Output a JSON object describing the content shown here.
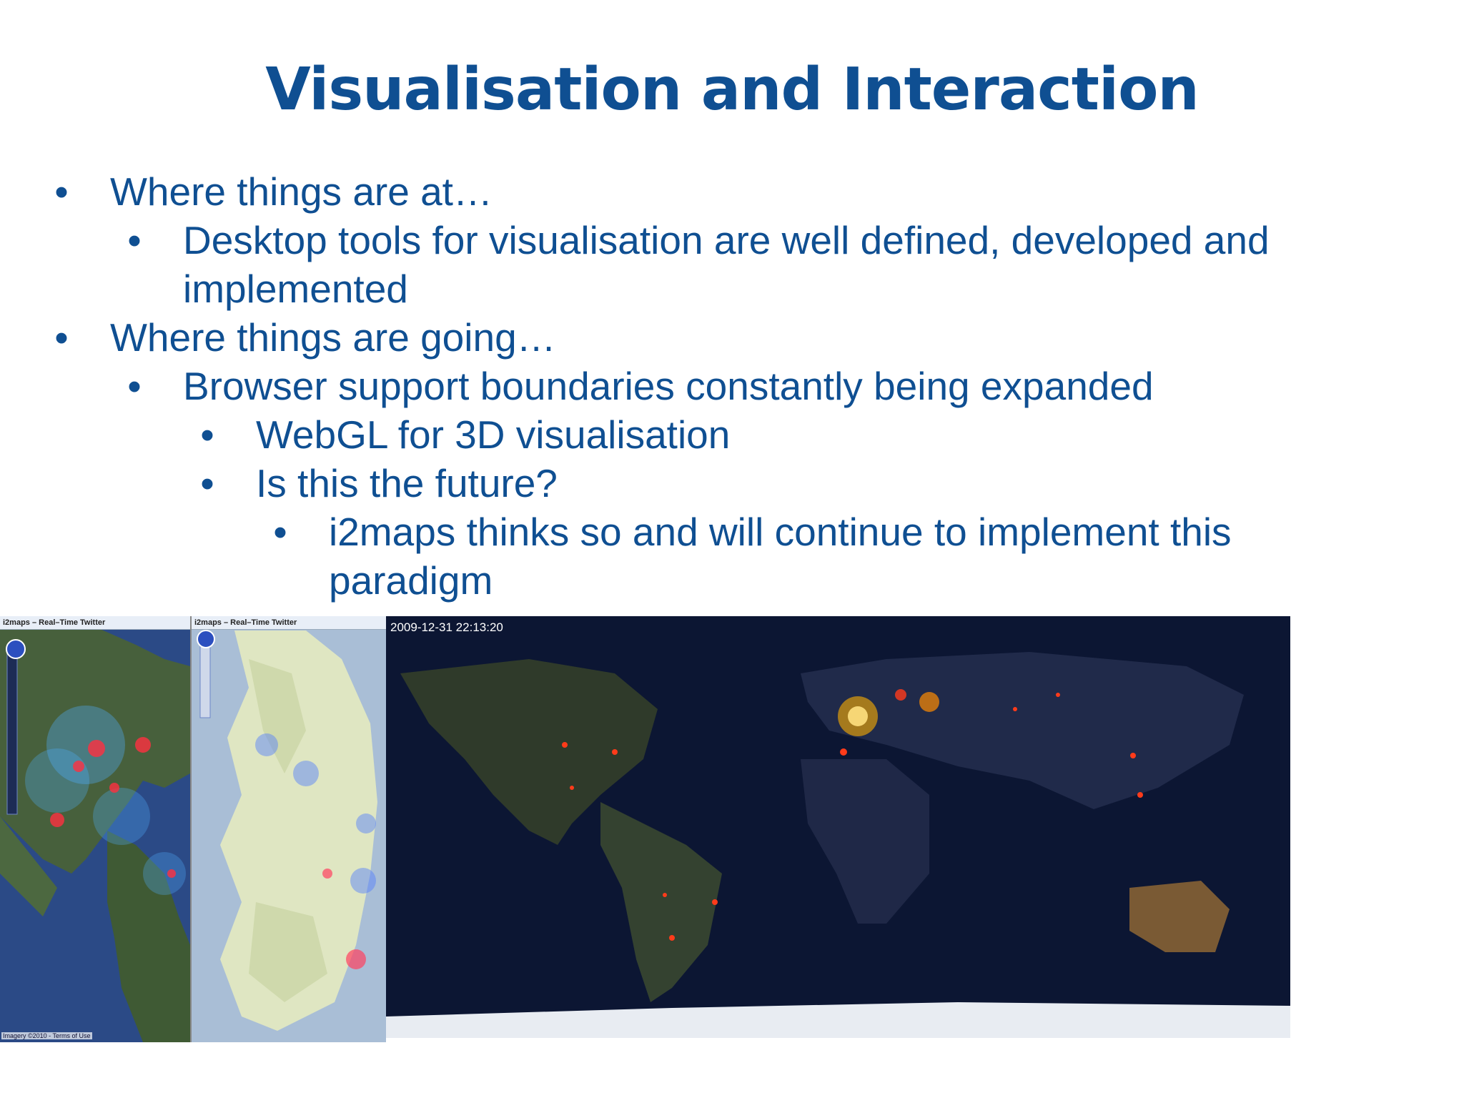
{
  "title": "Visualisation and Interaction",
  "bullets": [
    {
      "text": "Where things are at…"
    },
    {
      "text": "Desktop tools for visualisation are well defined, developed and"
    },
    {
      "text": "implemented"
    },
    {
      "text": "Where things are going…"
    },
    {
      "text": "Browser support boundaries constantly being expanded"
    },
    {
      "text": "WebGL for 3D visualisation"
    },
    {
      "text": "Is this the future?"
    },
    {
      "text": "i2maps thinks so and will continue to implement this"
    },
    {
      "text": "paradigm"
    }
  ],
  "bullet_symbol": "•",
  "figure": {
    "panel1_caption": "i2maps – Real–Time Twitter",
    "panel2_caption": "i2maps – Real–Time Twitter",
    "panel1_credit": "Imagery ©2010 - Terms of Use",
    "timestamp": "2009-12-31 22:13:20"
  },
  "colors": {
    "title": "#0f4f92",
    "text": "#0f4f92",
    "ocean_dark": "#0c1633",
    "land_dark": "#232c4d",
    "hotspot": "#ff3b1a"
  }
}
